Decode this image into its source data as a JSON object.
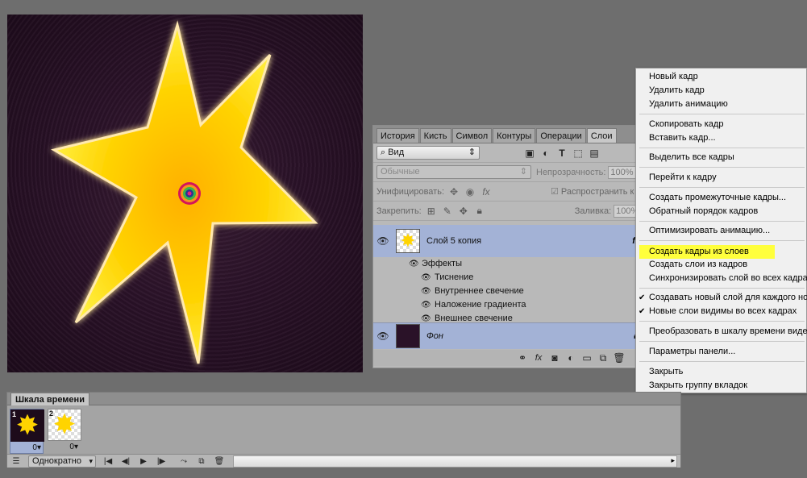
{
  "layers_panel": {
    "tabs": [
      "История",
      "Кисть",
      "Символ",
      "Контуры",
      "Операции",
      "Слои"
    ],
    "active_tab": "Слои",
    "filter_kind": "Вид",
    "blend_mode": "Обычные",
    "opacity_label": "Непрозрачность:",
    "opacity_value": "100%",
    "unify_label": "Унифицировать:",
    "propagate_label": "Распространить к",
    "lock_label": "Закрепить:",
    "fill_label": "Заливка:",
    "fill_value": "100%",
    "layers": [
      {
        "name": "Слой 5 копия",
        "fx": "fx"
      },
      {
        "name": "Фон"
      }
    ],
    "effects_label": "Эффекты",
    "effects": [
      "Тиснение",
      "Внутреннее свечение",
      "Наложение градиента",
      "Внешнее свечение"
    ],
    "bottom_icons": [
      "link-icon",
      "fx-icon",
      "mask-icon",
      "adjustment-icon",
      "folder-icon",
      "new-layer-icon",
      "trash-icon"
    ]
  },
  "context_menu": {
    "items": [
      {
        "label": "Новый кадр"
      },
      {
        "label": "Удалить кадр"
      },
      {
        "label": "Удалить анимацию"
      },
      {
        "label": "Скопировать кадр"
      },
      {
        "label": "Вставить кадр..."
      },
      {
        "label": "Выделить все кадры"
      },
      {
        "label": "Перейти к кадру"
      },
      {
        "label": "Создать промежуточные кадры..."
      },
      {
        "label": "Обратный порядок кадров"
      },
      {
        "label": "Оптимизировать анимацию..."
      },
      {
        "label": "Создать кадры из слоев",
        "highlighted": true
      },
      {
        "label": "Создать слои из кадров"
      },
      {
        "label": "Синхронизировать слой во всех кадрах..."
      },
      {
        "label": "Создавать новый слой для каждого нового кадра",
        "checked": true
      },
      {
        "label": "Новые слои видимы во всех кадрах",
        "checked": true
      },
      {
        "label": "Преобразовать в шкалу времени видео"
      },
      {
        "label": "Параметры панели..."
      },
      {
        "label": "Закрыть"
      },
      {
        "label": "Закрыть группу вкладок"
      }
    ]
  },
  "timeline": {
    "title": "Шкала времени",
    "frames": [
      {
        "number": "1",
        "delay": "0"
      },
      {
        "number": "2",
        "delay": "0"
      }
    ],
    "loop": "Однократно"
  },
  "colors": {
    "highlight": "#ffff3c",
    "selected_layer": "#a3b2d6",
    "star": "#ffd400"
  }
}
